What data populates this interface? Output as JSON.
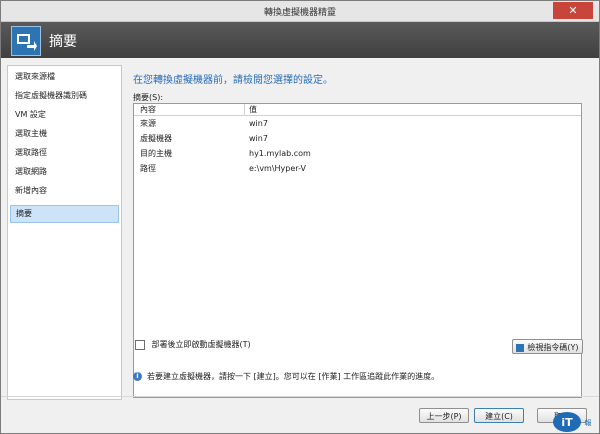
{
  "window": {
    "title": "轉換虛擬機器精靈",
    "close_glyph": "✕"
  },
  "header": {
    "title": "摘要",
    "icon": "convert-vm-icon"
  },
  "sidebar": {
    "items": [
      {
        "label": "選取來源檔"
      },
      {
        "label": "指定虛擬機器識別碼"
      },
      {
        "label": "VM 設定"
      },
      {
        "label": "選取主機"
      },
      {
        "label": "選取路徑"
      },
      {
        "label": "選取網路"
      },
      {
        "label": "新增內容"
      },
      {
        "label": "摘要",
        "active": true
      }
    ]
  },
  "main": {
    "headline": "在您轉換虛擬機器前，請檢閱您選擇的設定。",
    "summary_label": "摘要(S):",
    "columns": [
      "內容",
      "值"
    ],
    "rows": [
      {
        "property": "來源",
        "value": "win7"
      },
      {
        "property": "虛擬機器",
        "value": "win7"
      },
      {
        "property": "目的主機",
        "value": "hy1.mylab.com"
      },
      {
        "property": "路徑",
        "value": "e:\\vm\\Hyper-V"
      }
    ],
    "start_after_deploy": {
      "label": "部署後立即啟動虛擬機器(T)",
      "checked": false
    },
    "view_script_label": "檢視指令碼(Y)"
  },
  "info": {
    "text": "若要建立虛擬機器，請按一下 [建立]。您可以在 [作業] 工作區追蹤此作業的進度。"
  },
  "footer": {
    "prev_label": "上一步(P)",
    "create_label": "建立(C)",
    "cancel_label": "取消"
  },
  "logo": {
    "text": "iThome",
    "sub": "報導"
  }
}
